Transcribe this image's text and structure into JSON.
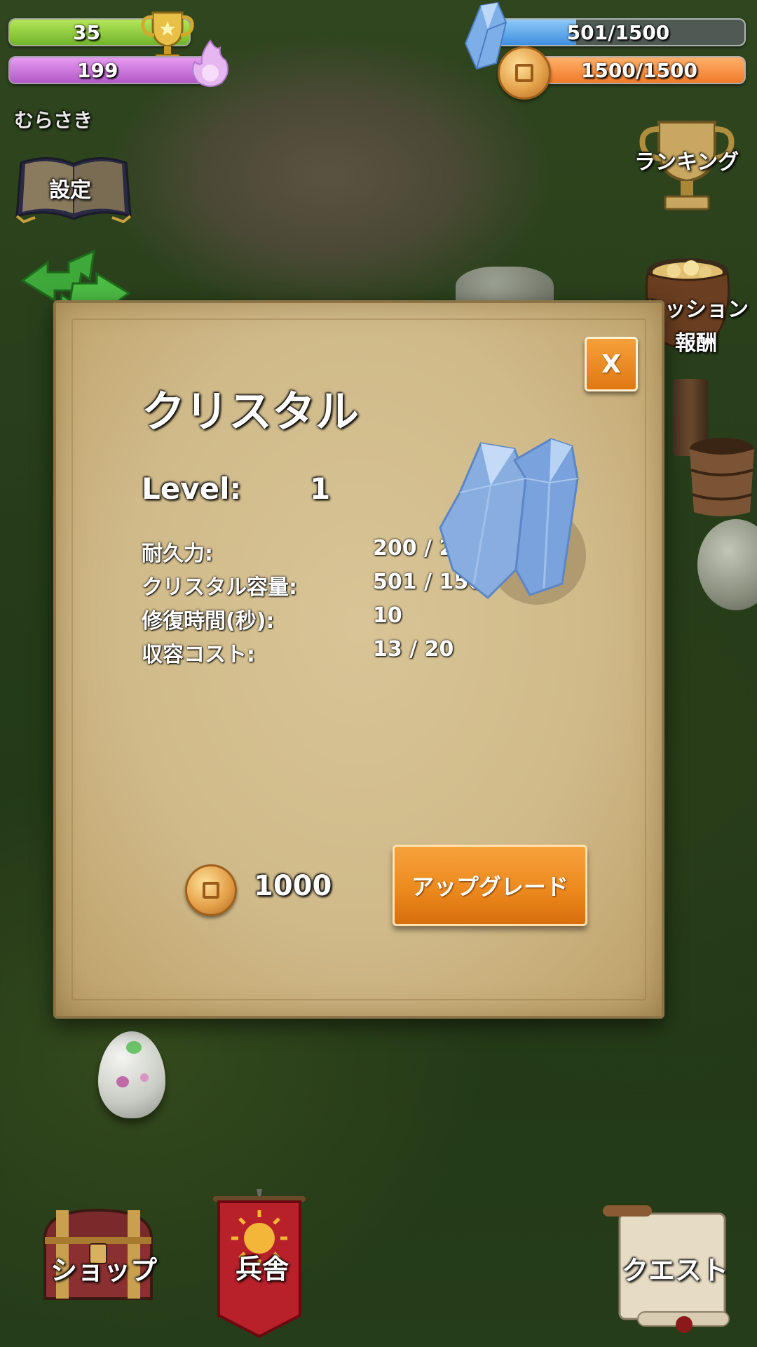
{
  "hud": {
    "trophies": "35",
    "energy": "199",
    "crystal": "501/1500",
    "crystal_fraction": 0.334,
    "coins": "1500/1500",
    "coins_fraction": 1.0
  },
  "left_menu": {
    "player_name": "むらさき",
    "settings": "設定"
  },
  "right_menu": {
    "ranking": "ランキング",
    "mission_line1": "ミッション",
    "mission_line2": "報酬"
  },
  "bottom_menu": {
    "shop": "ショップ",
    "barracks": "兵舎",
    "quest": "クエスト"
  },
  "dialog": {
    "title": "クリスタル",
    "close": "X",
    "level_label": "Level:",
    "level_value": "1",
    "stats": [
      {
        "label": "耐久力:",
        "value": "200 / 200"
      },
      {
        "label": "クリスタル容量:",
        "value": "501 / 1500"
      },
      {
        "label": "修復時間(秒):",
        "value": "10"
      },
      {
        "label": "収容コスト:",
        "value": "13 / 20"
      }
    ],
    "cost": "1000",
    "upgrade": "アップグレード"
  },
  "colors": {
    "accent_orange": "#ec8a1e",
    "trophy_bar": "#8ccb3a",
    "energy_bar": "#c972dc",
    "crystal_bar": "#5aa6ea",
    "coin_bar": "#f5913f"
  },
  "icons": [
    "trophy-icon",
    "flame-icon",
    "crystal-icon",
    "coin-icon",
    "book-icon",
    "arrows-icon",
    "ranking-trophy-icon",
    "pot-icon",
    "chest-icon",
    "banner-icon",
    "scroll-icon",
    "egg-icon"
  ]
}
